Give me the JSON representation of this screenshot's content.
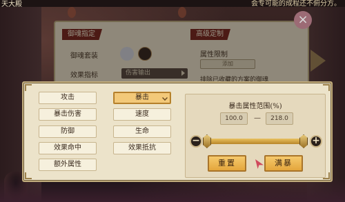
{
  "background": {
    "top_left_tag": "天大殿",
    "top_text": "会专可能的成程还不俯分方。"
  },
  "back_dialog": {
    "soul_assign_title": "御魂指定",
    "advanced_title": "高级定制",
    "soul_set_label": "御魂套装",
    "effect_index_label": "效果指标",
    "effect_index_value": "伤害输出",
    "attr_limit_label": "属性限制",
    "add_label": "添加",
    "exclude_text": "排除已收藏的方案的御魂",
    "close_label": "×"
  },
  "panel": {
    "attributes": [
      {
        "label": "攻击",
        "selected": false
      },
      {
        "label": "暴击",
        "selected": true
      },
      {
        "label": "暴击伤害",
        "selected": false
      },
      {
        "label": "速度",
        "selected": false
      },
      {
        "label": "防御",
        "selected": false
      },
      {
        "label": "生命",
        "selected": false
      },
      {
        "label": "效果命中",
        "selected": false
      },
      {
        "label": "效果抵抗",
        "selected": false
      },
      {
        "label": "额外属性",
        "selected": false
      }
    ],
    "range": {
      "title": "暴击属性范围(%)",
      "min_value": "100.0",
      "dash": "—",
      "max_value": "218.0",
      "minus_label": "−",
      "plus_label": "+",
      "slider_min_fraction": 0.02,
      "slider_max_fraction": 0.98
    },
    "reset_label": "重置",
    "max_label": "满暴"
  },
  "colors": {
    "panel_bg": "#ece3ca",
    "selected_bg": "#f3c979",
    "accent_red": "#7b2a22"
  }
}
